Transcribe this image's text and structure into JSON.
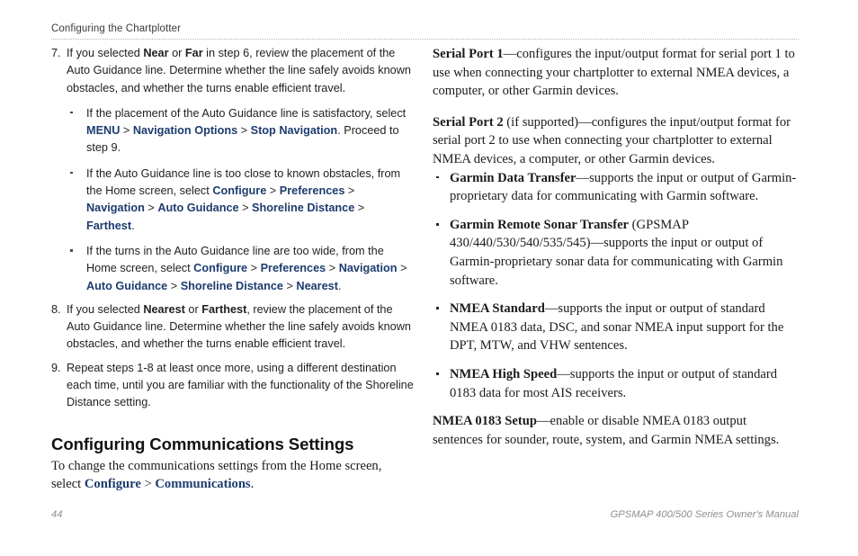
{
  "header": {
    "title": "Configuring the Chartplotter"
  },
  "left_column": {
    "steps": [
      {
        "number": "7.",
        "text_parts": [
          {
            "t": "If you selected ",
            "s": "plain"
          },
          {
            "t": "Near",
            "s": "bold"
          },
          {
            "t": " or ",
            "s": "plain"
          },
          {
            "t": "Far",
            "s": "bold"
          },
          {
            "t": " in step 6, review the placement of the Auto Guidance line. Determine whether the line safely avoids known obstacles, and whether the turns enable efficient travel.",
            "s": "plain"
          }
        ],
        "bullets": [
          [
            {
              "t": "If the placement of the Auto Guidance line is satisfactory, select ",
              "s": "plain"
            },
            {
              "t": "MENU",
              "s": "nav"
            },
            {
              "t": " > ",
              "s": "sep"
            },
            {
              "t": "Navigation Options",
              "s": "nav"
            },
            {
              "t": " > ",
              "s": "sep"
            },
            {
              "t": "Stop Navigation",
              "s": "nav"
            },
            {
              "t": ". Proceed to step 9.",
              "s": "plain"
            }
          ],
          [
            {
              "t": "If the Auto Guidance line is too close to known obstacles, from the Home screen, select ",
              "s": "plain"
            },
            {
              "t": "Configure",
              "s": "nav"
            },
            {
              "t": " > ",
              "s": "sep"
            },
            {
              "t": "Preferences",
              "s": "nav"
            },
            {
              "t": " > ",
              "s": "sep"
            },
            {
              "t": "Navigation",
              "s": "nav"
            },
            {
              "t": " > ",
              "s": "sep"
            },
            {
              "t": "Auto Guidance",
              "s": "nav"
            },
            {
              "t": " > ",
              "s": "sep"
            },
            {
              "t": "Shoreline Distance",
              "s": "nav"
            },
            {
              "t": " > ",
              "s": "sep"
            },
            {
              "t": "Farthest",
              "s": "nav"
            },
            {
              "t": ".",
              "s": "plain"
            }
          ],
          [
            {
              "t": "If the turns in the Auto Guidance line are too wide, from the Home screen, select ",
              "s": "plain"
            },
            {
              "t": "Configure",
              "s": "nav"
            },
            {
              "t": " > ",
              "s": "sep"
            },
            {
              "t": "Preferences",
              "s": "nav"
            },
            {
              "t": " > ",
              "s": "sep"
            },
            {
              "t": "Navigation",
              "s": "nav"
            },
            {
              "t": " > ",
              "s": "sep"
            },
            {
              "t": "Auto Guidance",
              "s": "nav"
            },
            {
              "t": " > ",
              "s": "sep"
            },
            {
              "t": "Shoreline Distance",
              "s": "nav"
            },
            {
              "t": " > ",
              "s": "sep"
            },
            {
              "t": "Nearest",
              "s": "nav"
            },
            {
              "t": ".",
              "s": "plain"
            }
          ]
        ]
      },
      {
        "number": "8.",
        "text_parts": [
          {
            "t": "If you selected ",
            "s": "plain"
          },
          {
            "t": "Nearest",
            "s": "bold"
          },
          {
            "t": " or ",
            "s": "plain"
          },
          {
            "t": "Farthest",
            "s": "bold"
          },
          {
            "t": ", review the placement of the Auto Guidance line. Determine whether the line safely avoids known obstacles, and whether the turns enable efficient travel.",
            "s": "plain"
          }
        ],
        "bullets": []
      },
      {
        "number": "9.",
        "text_parts": [
          {
            "t": "Repeat steps 1-8 at least once more, using a different destination each time, until you are familiar with the functionality of the Shoreline Distance setting.",
            "s": "plain"
          }
        ],
        "bullets": []
      }
    ],
    "section_heading": "Configuring Communications Settings",
    "section_intro": [
      {
        "t": "To change the communications settings from the Home screen, select ",
        "s": "plain"
      },
      {
        "t": "Configure",
        "s": "nav"
      },
      {
        "t": " > ",
        "s": "sep"
      },
      {
        "t": "Communications",
        "s": "nav"
      },
      {
        "t": ".",
        "s": "plain"
      }
    ]
  },
  "right_column": {
    "paragraphs_top": [
      [
        {
          "t": "Serial Port 1",
          "s": "bold"
        },
        {
          "t": "—configures the input/output format for serial port 1 to use when connecting your chartplotter to external NMEA devices, a computer, or other Garmin devices.",
          "s": "plain"
        }
      ],
      [
        {
          "t": "Serial Port 2",
          "s": "bold"
        },
        {
          "t": " (if supported)—configures the input/output format for serial port 2 to use when connecting your chartplotter to external NMEA devices, a computer, or other Garmin devices.",
          "s": "plain"
        }
      ]
    ],
    "bullets": [
      [
        {
          "t": "Garmin Data Transfer",
          "s": "bold"
        },
        {
          "t": "—supports the input or output of Garmin-proprietary data for communicating with Garmin software.",
          "s": "plain"
        }
      ],
      [
        {
          "t": "Garmin Remote Sonar Transfer",
          "s": "bold"
        },
        {
          "t": " (GPSMAP 430/440/530/540/535/545)—supports the input or output of Garmin-proprietary sonar data for communicating with Garmin software.",
          "s": "plain"
        }
      ],
      [
        {
          "t": "NMEA Standard",
          "s": "bold"
        },
        {
          "t": "—supports the input or output of standard NMEA 0183 data, DSC, and sonar NMEA input support for the DPT, MTW, and VHW sentences.",
          "s": "plain"
        }
      ],
      [
        {
          "t": "NMEA High Speed",
          "s": "bold"
        },
        {
          "t": "—supports the input or output of standard 0183 data for most AIS receivers.",
          "s": "plain"
        }
      ]
    ],
    "paragraphs_bottom": [
      [
        {
          "t": "NMEA 0183 Setup",
          "s": "bold"
        },
        {
          "t": "—enable or disable NMEA 0183 output sentences for sounder, route, system, and Garmin NMEA settings.",
          "s": "plain"
        }
      ]
    ]
  },
  "footer": {
    "page_number": "44",
    "manual_title": "GPSMAP 400/500 Series Owner's Manual"
  },
  "colors": {
    "nav_link": "#1d3c6e",
    "body_text": "#1b1b1b",
    "header_text": "#3b3b3b",
    "footer_text": "#8e8e8e",
    "rule": "#b6b6b6"
  }
}
